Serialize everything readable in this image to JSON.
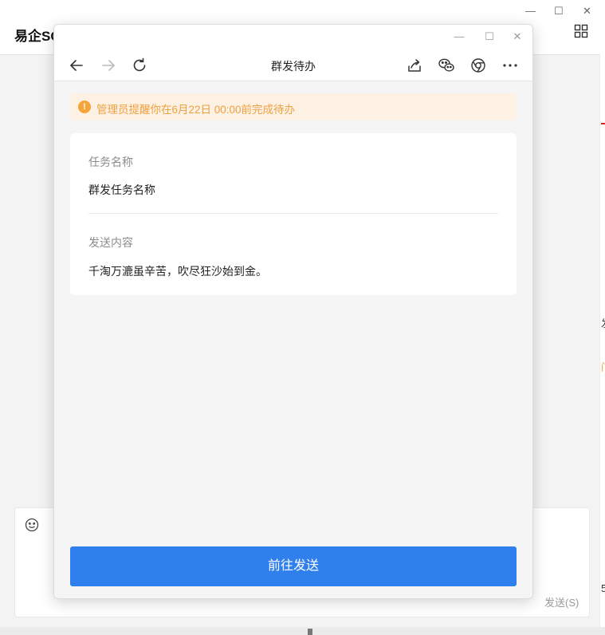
{
  "background_app": {
    "title": "易企SC",
    "send_label": "发送(S)",
    "window_controls": [
      "—",
      "☐",
      "✕"
    ],
    "edge_fragments": [
      "发",
      "门",
      "5"
    ]
  },
  "popup": {
    "window_controls": [
      "—",
      "☐",
      "✕"
    ],
    "title": "群发待办",
    "notice": "管理员提醒你在6月22日 00:00前完成待办",
    "notice_icon_glyph": "!",
    "fields": [
      {
        "label": "任务名称",
        "value": "群发任务名称"
      },
      {
        "label": "发送内容",
        "value": "千淘万漉虽辛苦，吹尽狂沙始到金。"
      }
    ],
    "primary_button": "前往发送"
  },
  "colors": {
    "primary": "#2f80ed",
    "notice_bg": "#fdf1e3",
    "notice_text": "#f0a040",
    "accent_red": "#e02020"
  }
}
